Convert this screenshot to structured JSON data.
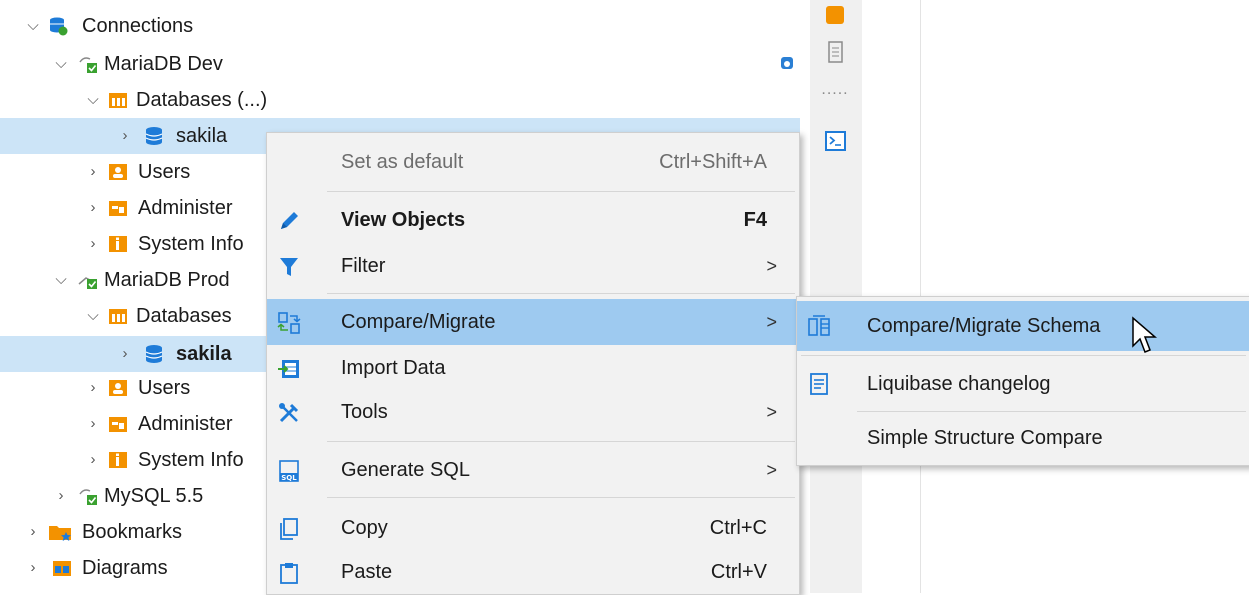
{
  "tree": {
    "connections_label": "Connections",
    "mariadb_dev": {
      "label": "MariaDB Dev",
      "databases_label": "Databases (...)",
      "schema_label": "sakila",
      "users_label": "Users",
      "admin_label": "Administer",
      "sysinfo_label": "System Info"
    },
    "mariadb_prod": {
      "label": "MariaDB Prod",
      "databases_label": "Databases",
      "schema_label": "sakila",
      "users_label": "Users",
      "admin_label": "Administer",
      "sysinfo_label": "System Info"
    },
    "mysql_label": "MySQL 5.5",
    "bookmarks_label": "Bookmarks",
    "diagrams_label": "Diagrams"
  },
  "toolbar": {
    "dots": "....."
  },
  "context_menu": {
    "set_default": {
      "label": "Set as default",
      "shortcut": "Ctrl+Shift+A"
    },
    "view_objects": {
      "label": "View  Objects",
      "shortcut": "F4"
    },
    "filter": {
      "label": "Filter",
      "arrow": ">"
    },
    "compare_migrate": {
      "label": "Compare/Migrate",
      "arrow": ">"
    },
    "import_data": {
      "label": "Import Data"
    },
    "tools": {
      "label": "Tools",
      "arrow": ">"
    },
    "generate_sql": {
      "label": "Generate SQL",
      "arrow": ">"
    },
    "copy": {
      "label": "Copy",
      "shortcut": "Ctrl+C"
    },
    "paste": {
      "label": "Paste",
      "shortcut": "Ctrl+V"
    }
  },
  "submenu": {
    "compare_schema": "Compare/Migrate Schema",
    "liquibase": "Liquibase changelog",
    "simple_compare": "Simple Structure Compare"
  },
  "colors": {
    "selection": "#cce4f7",
    "menu_highlight": "#9ecaf0",
    "menu_bg": "#f2f2f2",
    "accent_blue": "#1e7bd8",
    "folder_orange": "#f39200",
    "green_check": "#3aa130"
  }
}
